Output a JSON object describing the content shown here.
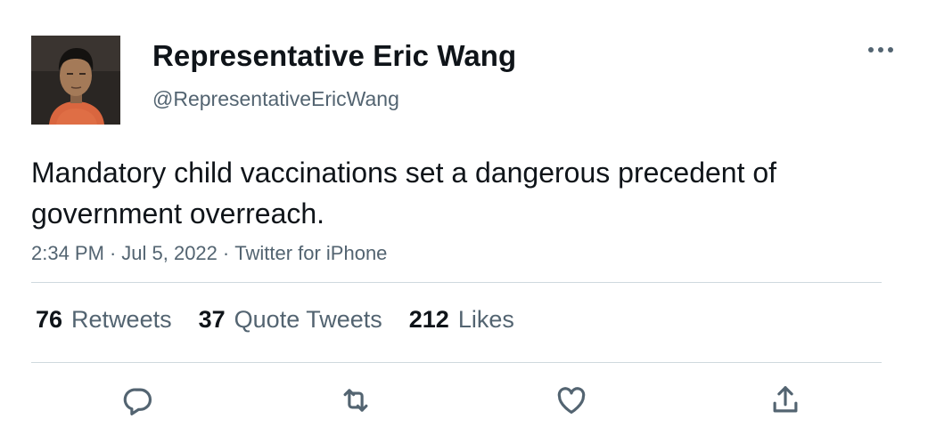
{
  "author": {
    "display_name": "Representative Eric Wang",
    "handle": "@RepresentativeEricWang",
    "avatar": "profile-photo"
  },
  "tweet": {
    "text": "Mandatory child vaccinations set a dangerous precedent of government overreach.",
    "time": "2:34 PM",
    "date": "Jul 5, 2022",
    "source": "Twitter for iPhone",
    "separator": "·"
  },
  "stats": [
    {
      "count": "76",
      "label": "Retweets"
    },
    {
      "count": "37",
      "label": "Quote Tweets"
    },
    {
      "count": "212",
      "label": "Likes"
    }
  ],
  "icons": {
    "more": "more-horizontal-icon",
    "reply": "reply-icon",
    "retweet": "retweet-icon",
    "like": "heart-icon",
    "share": "share-icon"
  },
  "colors": {
    "primary_text": "#0f1419",
    "secondary_text": "#536471",
    "divider": "#cfd9de"
  }
}
